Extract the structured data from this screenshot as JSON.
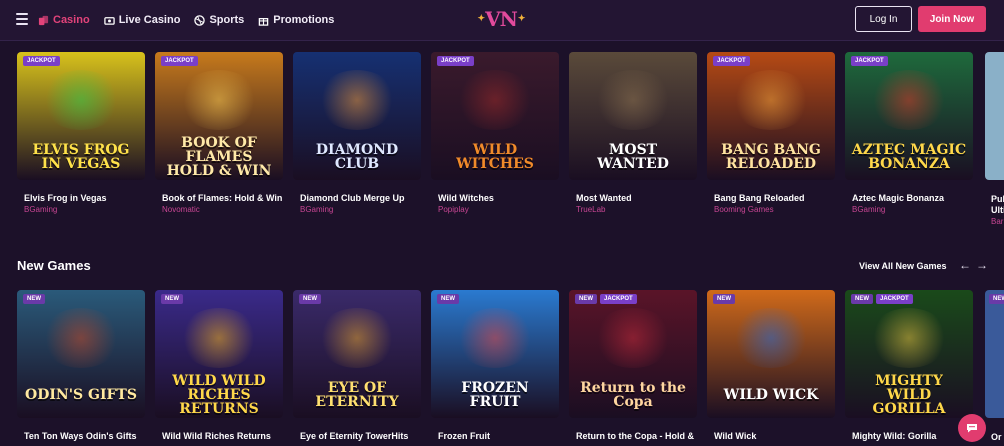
{
  "header": {
    "nav": [
      {
        "label": "Casino",
        "icon": "cards-icon",
        "active": true
      },
      {
        "label": "Live Casino",
        "icon": "live-dealer-icon",
        "active": false
      },
      {
        "label": "Sports",
        "icon": "ball-icon",
        "active": false
      },
      {
        "label": "Promotions",
        "icon": "gift-icon",
        "active": false
      }
    ],
    "logo": "VN",
    "login_label": "Log In",
    "join_label": "Join Now"
  },
  "colors": {
    "accent": "#e13c6f",
    "background": "#1c1129",
    "provider_text": "#c64592",
    "badge": "#7a3fc8"
  },
  "jackpot_games": [
    {
      "name": "Elvis Frog in Vegas",
      "provider": "BGaming",
      "badges": [
        "JACKPOT"
      ],
      "art": "ELVIS FROG IN VEGAS",
      "bg": "#d8c21b",
      "glow": "#35c94a",
      "ink": "#ffe24a"
    },
    {
      "name": "Book of Flames: Hold & Win",
      "provider": "Novomatic",
      "badges": [
        "JACKPOT"
      ],
      "art": "BOOK OF FLAMES HOLD & WIN",
      "bg": "#c77a1c",
      "glow": "#f4c652",
      "ink": "#ffe9a8"
    },
    {
      "name": "Diamond Club Merge Up",
      "provider": "BGaming",
      "badges": [],
      "art": "DIAMOND CLUB",
      "bg": "#163072",
      "glow": "#e8953a",
      "ink": "#dfe8ff"
    },
    {
      "name": "Wild Witches",
      "provider": "Popiplay",
      "badges": [
        "JACKPOT"
      ],
      "art": "WILD WITCHES",
      "bg": "#3a1a2c",
      "glow": "#9a2a2a",
      "ink": "#f08a2a"
    },
    {
      "name": "Most Wanted",
      "provider": "TrueLab",
      "badges": [],
      "art": "MOST WANTED",
      "bg": "#5a4a3a",
      "glow": "#8a7050",
      "ink": "#ffffff"
    },
    {
      "name": "Bang Bang Reloaded",
      "provider": "Booming Games",
      "badges": [
        "JACKPOT"
      ],
      "art": "BANG BANG RELOADED",
      "bg": "#b64a14",
      "glow": "#f0a03a",
      "ink": "#ffe3a0"
    },
    {
      "name": "Aztec Magic Bonanza",
      "provider": "BGaming",
      "badges": [
        "JACKPOT"
      ],
      "art": "AZTEC MAGIC BONANZA",
      "bg": "#1e6a3c",
      "glow": "#d63a2a",
      "ink": "#ffd84a"
    }
  ],
  "jackpot_edge": {
    "name": "Pul",
    "line2": "Ulti",
    "provider": "Bar"
  },
  "new_games": {
    "title": "New Games",
    "view_all": "View All New Games",
    "prev_icon": "arrow-left-icon",
    "next_icon": "arrow-right-icon",
    "items": [
      {
        "name": "Ten Ton Ways Odin's Gifts",
        "badges": [
          "NEW"
        ],
        "art": "ODIN'S GIFTS",
        "bg": "#2a5a7a",
        "glow": "#c04a2a",
        "ink": "#ffe9a0"
      },
      {
        "name": "Wild Wild Riches Returns",
        "badges": [
          "NEW"
        ],
        "art": "WILD WILD RICHES RETURNS",
        "bg": "#3a2a8a",
        "glow": "#f0b020",
        "ink": "#ffd84a"
      },
      {
        "name": "Eye of Eternity TowerHits",
        "badges": [
          "NEW"
        ],
        "art": "EYE OF ETERNITY",
        "bg": "#3a2a6a",
        "glow": "#e0a030",
        "ink": "#ffe070"
      },
      {
        "name": "Frozen Fruit",
        "badges": [
          "NEW"
        ],
        "art": "FROZEN FRUIT",
        "bg": "#2a7ad0",
        "glow": "#e04a4a",
        "ink": "#ffffff"
      },
      {
        "name": "Return to the Copa - Hold &",
        "badges": [
          "NEW",
          "JACKPOT"
        ],
        "art": "Return to the Copa",
        "bg": "#5a1428",
        "glow": "#c02a3a",
        "ink": "#ffd6a0"
      },
      {
        "name": "Wild Wick",
        "badges": [
          "NEW"
        ],
        "art": "WILD WICK",
        "bg": "#d06a1a",
        "glow": "#2a6ad0",
        "ink": "#ffffff"
      },
      {
        "name": "Mighty Wild: Gorilla",
        "badges": [
          "NEW",
          "JACKPOT"
        ],
        "art": "MIGHTY WILD GORILLA",
        "bg": "#1a4a1a",
        "glow": "#e0c040",
        "ink": "#ffd84a"
      }
    ],
    "edge": {
      "name": "Or",
      "badges": [
        "NEW"
      ]
    }
  },
  "chat_icon": "chat-bubble-icon"
}
